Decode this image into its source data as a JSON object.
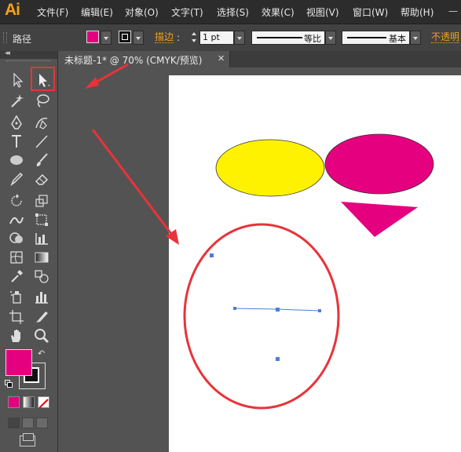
{
  "app": {
    "logo": "Ai",
    "menu": [
      "文件(F)",
      "编辑(E)",
      "对象(O)",
      "文字(T)",
      "选择(S)",
      "效果(C)",
      "视图(V)",
      "窗口(W)",
      "帮助(H)"
    ]
  },
  "control_bar": {
    "selection_label": "路径",
    "fill_color": "#e4007f",
    "stroke_link": "描边",
    "stroke_weight": "1 pt",
    "profile_label": "等比",
    "brush_label": "基本",
    "opacity_link": "不透明"
  },
  "document": {
    "tab_title": "未标题-1* @ 70% (CMYK/预览)",
    "close_glyph": "✕"
  },
  "toolbox": {
    "fill_color": "#e4007f",
    "stroke_color": "#111111",
    "swap_glyph": "↶",
    "highlight_color": "#e8333a"
  },
  "artwork": {
    "yellow_ellipse_color": "#fff200",
    "magenta_ellipse_color": "#e4007f",
    "magenta_triangle_color": "#e4007f",
    "annotation_color": "#e8333a",
    "selection_color": "#4a7fd6"
  }
}
